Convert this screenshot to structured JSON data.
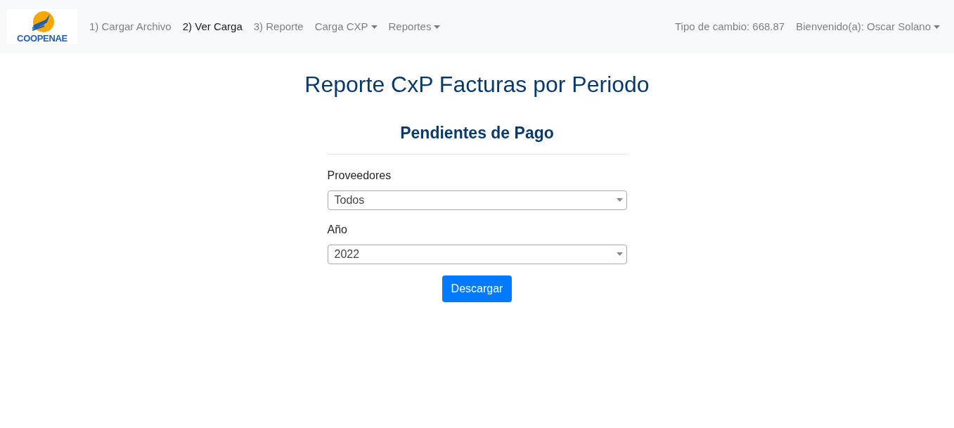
{
  "navbar": {
    "logo_text": "COOPENAE",
    "items": [
      {
        "label": "1) Cargar Archivo",
        "selected": false,
        "kind": "link"
      },
      {
        "label": "2) Ver Carga",
        "selected": true,
        "kind": "link"
      },
      {
        "label": "3) Reporte",
        "selected": false,
        "kind": "link"
      },
      {
        "label": "Carga CXP",
        "selected": false,
        "kind": "dropdown"
      },
      {
        "label": "Reportes",
        "selected": false,
        "kind": "dropdown"
      }
    ],
    "exchange_rate": "Tipo de cambio: 668.87",
    "user_menu": "Bienvenido(a): Oscar Solano"
  },
  "page_title": "Reporte CxP Facturas por Periodo",
  "form": {
    "title": "Pendientes de Pago",
    "fields": [
      {
        "label": "Proveedores",
        "value": "Todos"
      },
      {
        "label": "Año",
        "value": "2022"
      }
    ],
    "button": "Descargar"
  }
}
